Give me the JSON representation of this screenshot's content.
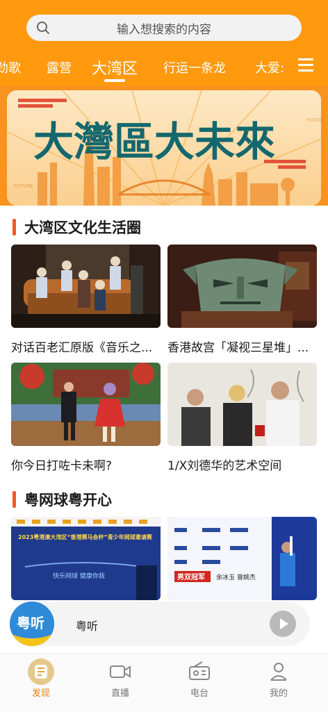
{
  "search": {
    "placeholder": "输入想搜索的内容"
  },
  "tabs": [
    {
      "label": "劲歌"
    },
    {
      "label": "露营"
    },
    {
      "label": "大湾区",
      "active": true
    },
    {
      "label": "行运一条龙"
    },
    {
      "label": "大爱:"
    }
  ],
  "banner": {
    "title": "大灣區大未來",
    "sub": "FUTURE"
  },
  "section1": {
    "title": "大湾区文化生活圈",
    "cards": [
      {
        "title": "对话百老汇原版《音乐之..."
      },
      {
        "title": "香港故宫「凝视三星堆」..."
      },
      {
        "title": "你今日打咗卡未啊?"
      },
      {
        "title": "1/X刘德华的艺术空间"
      }
    ]
  },
  "section2": {
    "title": "粤网球粤开心",
    "poster1": {
      "year_title": "2023粤港澳大湾区“香港赛马会杯”青少年网球邀请赛",
      "slogan": "快乐网球 健康你我"
    },
    "poster2": {
      "badge": "男双冠军",
      "names": "余冰玉 曾姚杰"
    }
  },
  "player": {
    "logo": "粤听",
    "title": "粤听"
  },
  "nav": [
    {
      "label": "发现",
      "icon": "discover-icon",
      "active": true
    },
    {
      "label": "直播",
      "icon": "video-camera-icon"
    },
    {
      "label": "电台",
      "icon": "radio-icon"
    },
    {
      "label": "我的",
      "icon": "user-icon"
    }
  ],
  "colors": {
    "brand": "#ff9a0e",
    "accent": "#ee5b2a",
    "active_nav": "#e8820b"
  }
}
